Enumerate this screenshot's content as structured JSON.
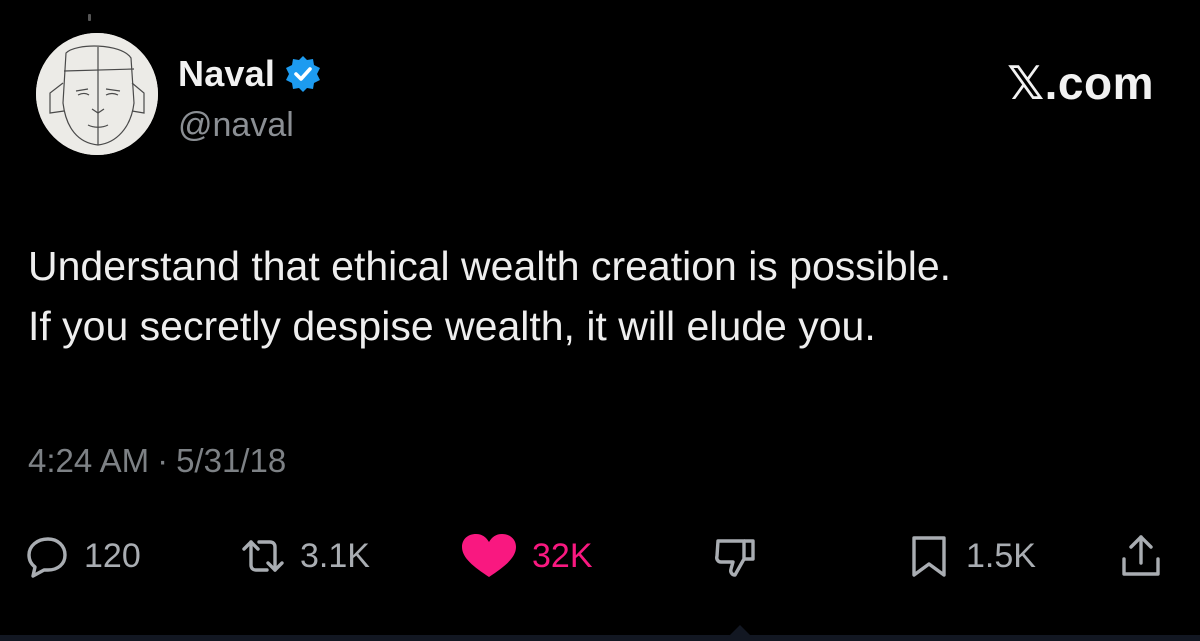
{
  "author": {
    "display_name": "Naval",
    "handle": "@naval",
    "verified_icon": "verified-badge-icon",
    "avatar_icon": "sketched-face-avatar"
  },
  "brand": "𝕏.com",
  "tweet": {
    "lines": [
      "Understand that ethical wealth creation is possible.",
      "If you secretly despise wealth, it will elude you."
    ],
    "time": "4:24 AM",
    "separator": "·",
    "date": "5/31/18"
  },
  "actions": {
    "reply": {
      "icon": "reply-icon",
      "count": "120"
    },
    "repost": {
      "icon": "repost-icon",
      "count": "3.1K"
    },
    "like": {
      "icon": "heart-icon",
      "count": "32K",
      "active": true
    },
    "dislike": {
      "icon": "dislike-icon"
    },
    "bookmark": {
      "icon": "bookmark-icon",
      "count": "1.5K"
    },
    "share": {
      "icon": "share-icon"
    }
  },
  "colors": {
    "background": "#000000",
    "text": "#e7e9ea",
    "muted": "#7d8185",
    "verified": "#1d9bf0",
    "like": "#f91880"
  }
}
